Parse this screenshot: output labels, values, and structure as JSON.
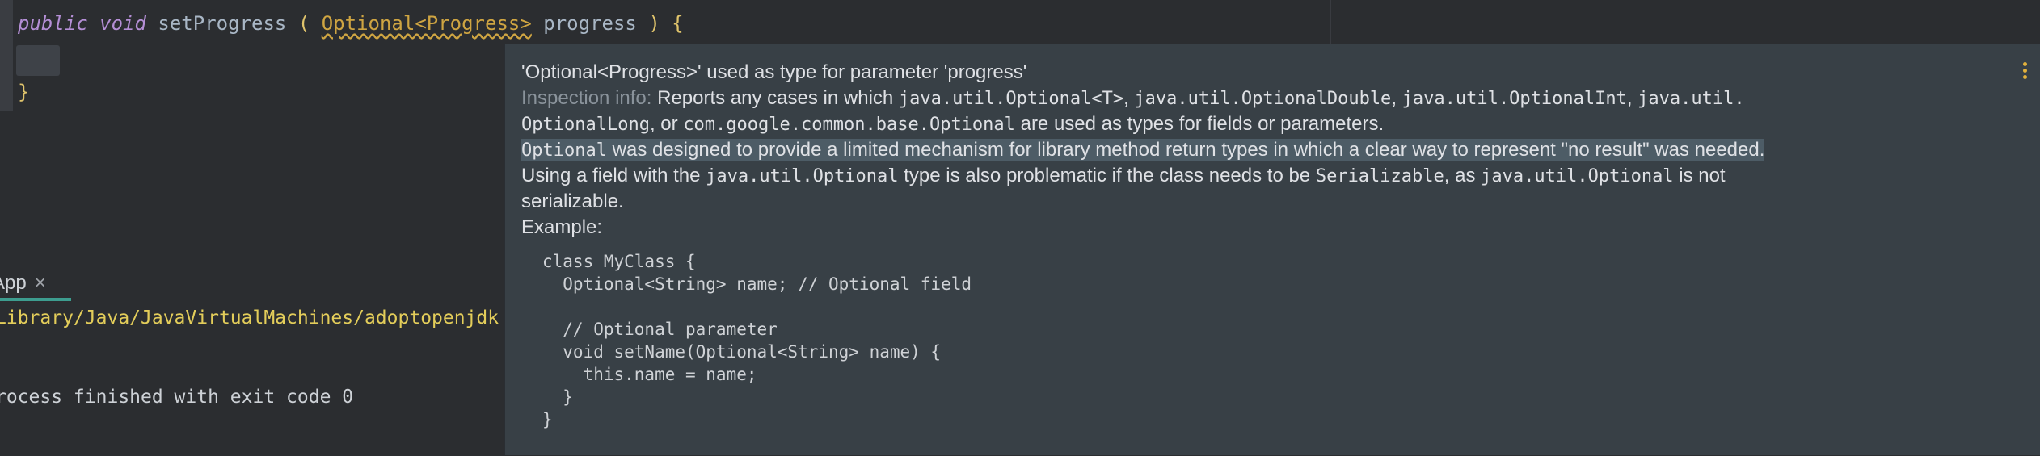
{
  "editor": {
    "line1": {
      "kw_public": "public",
      "kw_void": "void",
      "method": "setProgress",
      "open_paren": "(",
      "param_type": "Optional<Progress>",
      "param_name": "progress",
      "close_paren": ")",
      "open_brace": "{"
    },
    "line3_brace": "}"
  },
  "run_panel": {
    "tab_label": "App",
    "tab_close": "×",
    "path_text": "Library/Java/JavaVirtualMachines/adoptopenjdk",
    "exit_text": "rocess finished with exit code 0"
  },
  "popup": {
    "title": "'Optional<Progress>' used as type for parameter 'progress'",
    "info": {
      "label": "Inspection info:",
      "l1_t1": "Reports any cases in which",
      "l1_c1": "java.util.Optional<T>",
      "l1_t2": ",",
      "l1_c2": "java.util.OptionalDouble",
      "l1_t3": ",",
      "l1_c3": "java.util.OptionalInt",
      "l1_t4": ",",
      "l1_c4": "java.util.",
      "l2_c1": "OptionalLong",
      "l2_t1": ", or",
      "l2_c2": "com.google.common.base.Optional",
      "l2_t2": "are used as types for fields or parameters.",
      "l3_c1": "Optional",
      "l3_t1": "was designed to provide a limited mechanism for library method return types in which a clear way to represent \"no result\" was needed.",
      "l4_t1": "Using a field with the",
      "l4_c1": "java.util.Optional",
      "l4_t2": "type is also problematic if the class needs to be",
      "l4_c2": "Serializable",
      "l4_t3": ", as",
      "l4_c3": "java.util.Optional",
      "l4_t4": "is not",
      "l5_t1": "serializable.",
      "example_label": "Example:"
    },
    "code_example": "class MyClass {\n  Optional<String> name; // Optional field\n\n  // Optional parameter\n  void setName(Optional<String> name) {\n    this.name = name;\n  }\n}"
  }
}
